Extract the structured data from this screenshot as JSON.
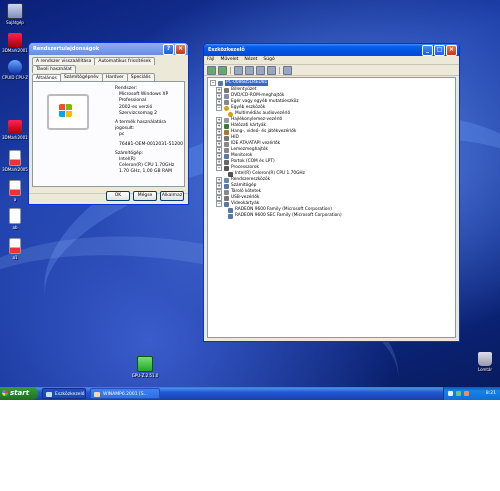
{
  "desktop": {
    "icons": [
      {
        "label": "Sajátgép"
      },
      {
        "label": "3DMark2001"
      },
      {
        "label": "CPUID CPU-Z"
      },
      {
        "label": "3DMark2001SE"
      },
      {
        "label": "3DMark2005"
      },
      {
        "label": "a"
      },
      {
        "label": "ab"
      },
      {
        "label": "a1"
      }
    ],
    "bottom_icons": [
      {
        "label": "GPU-Z.2.51.0"
      },
      {
        "label": "Lomtár"
      }
    ]
  },
  "sysprops": {
    "title": "Rendszertulajdonságok",
    "tabs_row1": [
      "A rendszer visszaállítása",
      "Automatikus frissítések",
      "Távoli használat"
    ],
    "tabs_row2": [
      "Általános",
      "Számítógépnév",
      "Hardver",
      "Speciális"
    ],
    "system_heading": "Rendszer:",
    "os_lines": [
      "Microsoft Windows XP",
      "Professional",
      "2002-es verzió",
      "Szervizcsomag 2"
    ],
    "registered_heading": "A termék használatára jogosult:",
    "registered_user": "pc",
    "product_id": "76481-OEM-0012031-51200",
    "computer_heading": "Számítógép:",
    "computer_lines": [
      "Intel(R)",
      "Celeron(R) CPU 1.70GHz",
      "1.70 GHz, 1,00 GB RAM"
    ],
    "buttons": {
      "ok": "OK",
      "cancel": "Mégse",
      "apply": "Alkalmaz"
    }
  },
  "devmgr": {
    "title": "Eszközkezelő",
    "menu": [
      "Fájl",
      "Művelet",
      "Nézet",
      "Súgó"
    ],
    "root": "PC-0086B5D4ED81",
    "categories": [
      {
        "label": "Billentyűzet",
        "color": "#777777"
      },
      {
        "label": "DVD/CD-ROM-meghajtók",
        "color": "#8888aa"
      },
      {
        "label": "Egér vagy egyéb mutatóeszköz",
        "color": "#888888"
      },
      {
        "label": "Egyéb eszközök",
        "color": "#d4a017",
        "expanded": true
      },
      {
        "label": "Hajlékonylemez-vezérlő",
        "color": "#999999"
      },
      {
        "label": "Hálózati kártyák",
        "color": "#3a7a3a"
      },
      {
        "label": "Hang-, videó- és játékvezérlők",
        "color": "#aa7733"
      },
      {
        "label": "HID",
        "color": "#777777"
      },
      {
        "label": "IDE ATA/ATAPI vezérlők",
        "color": "#888888"
      },
      {
        "label": "Lemezmeghajtók",
        "color": "#888888"
      },
      {
        "label": "Monitorok",
        "color": "#5577aa"
      },
      {
        "label": "Portok (COM és LPT)",
        "color": "#666666"
      },
      {
        "label": "Processzorok",
        "color": "#555555",
        "expanded": true
      },
      {
        "label": "Rendszereszközök",
        "color": "#6688aa"
      },
      {
        "label": "Számítógép",
        "color": "#5577aa"
      },
      {
        "label": "Tároló kötetek",
        "color": "#888888"
      },
      {
        "label": "USB-vezérlők",
        "color": "#777777"
      },
      {
        "label": "Videokártyák",
        "color": "#5577aa",
        "expanded": true
      }
    ],
    "children": {
      "other": [
        "Multimédiás audiovezérlő"
      ],
      "cpu": [
        "Intel(R) Celeron(R) CPU 1.70GHz"
      ],
      "video": [
        "RADEON 9600 Family (Microsoft Corporation)",
        "RADEON 9600 SEC Family (Microsoft Corporation)"
      ]
    }
  },
  "taskbar": {
    "start": "start",
    "tasks": [
      {
        "label": "Eszközkezelő",
        "active": true
      },
      {
        "label": "WINAMP6.2001 [S..."
      }
    ],
    "clock": "8:21"
  }
}
